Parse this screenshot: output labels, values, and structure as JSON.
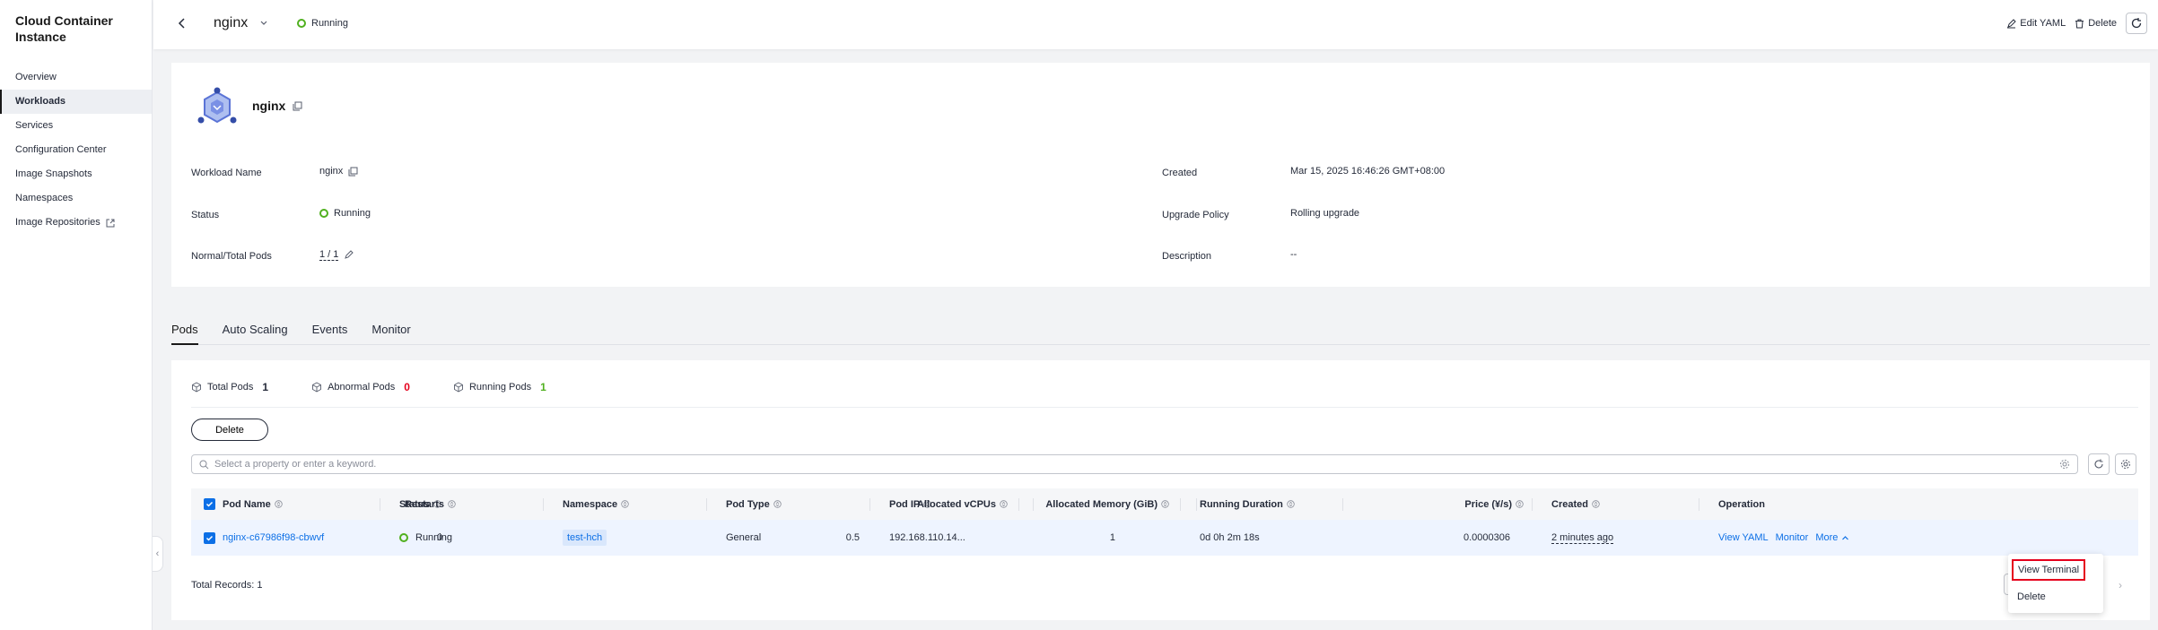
{
  "sidebar": {
    "app_title": "Cloud Container Instance",
    "items": [
      {
        "label": "Overview"
      },
      {
        "label": "Workloads",
        "active": true
      },
      {
        "label": "Services"
      },
      {
        "label": "Configuration Center"
      },
      {
        "label": "Image Snapshots"
      },
      {
        "label": "Namespaces"
      },
      {
        "label": "Image Repositories",
        "external": true
      }
    ]
  },
  "header": {
    "workload_name": "nginx",
    "status": "Running",
    "edit_yaml": "Edit YAML",
    "delete": "Delete"
  },
  "detail": {
    "title": "nginx",
    "fields": {
      "workload_name_label": "Workload Name",
      "workload_name_value": "nginx",
      "status_label": "Status",
      "status_value": "Running",
      "pods_label": "Normal/Total Pods",
      "pods_value": "1 / 1",
      "created_label": "Created",
      "created_value": "Mar 15, 2025 16:46:26 GMT+08:00",
      "upgrade_label": "Upgrade Policy",
      "upgrade_value": "Rolling upgrade",
      "description_label": "Description",
      "description_value": "--"
    }
  },
  "tabs": [
    {
      "label": "Pods",
      "active": true
    },
    {
      "label": "Auto Scaling"
    },
    {
      "label": "Events"
    },
    {
      "label": "Monitor"
    }
  ],
  "pods": {
    "stats": {
      "total_label": "Total Pods",
      "total_value": "1",
      "abnormal_label": "Abnormal Pods",
      "abnormal_value": "0",
      "running_label": "Running Pods",
      "running_value": "1"
    },
    "delete_label": "Delete",
    "search_placeholder": "Select a property or enter a keyword.",
    "columns": {
      "name": "Pod Name",
      "status": "Status",
      "namespace": "Namespace",
      "type": "Pod Type",
      "ip": "Pod IP",
      "restarts": "Restarts",
      "vcpus": "Allocated vCPUs",
      "memory": "Allocated Memory (GiB)",
      "duration": "Running Duration",
      "price": "Price (¥/s)",
      "created": "Created",
      "operation": "Operation"
    },
    "row": {
      "name": "nginx-c67986f98-cbwvf",
      "status": "Running",
      "namespace": "test-hch",
      "type": "General",
      "ip": "192.168.110.14...",
      "restarts": "0",
      "vcpus": "0.5",
      "memory": "1",
      "duration": "0d 0h 2m 18s",
      "price": "0.0000306",
      "created": "2 minutes ago",
      "op_view_yaml": "View YAML",
      "op_monitor": "Monitor",
      "op_more": "More"
    },
    "total_records": "Total Records: 1"
  },
  "more_menu": {
    "view_terminal": "View Terminal",
    "delete": "Delete"
  },
  "colors": {
    "accent": "#0c6fe6",
    "running": "#50b01f",
    "abnormal": "#e5001c",
    "highlight_border": "#e5001c"
  }
}
